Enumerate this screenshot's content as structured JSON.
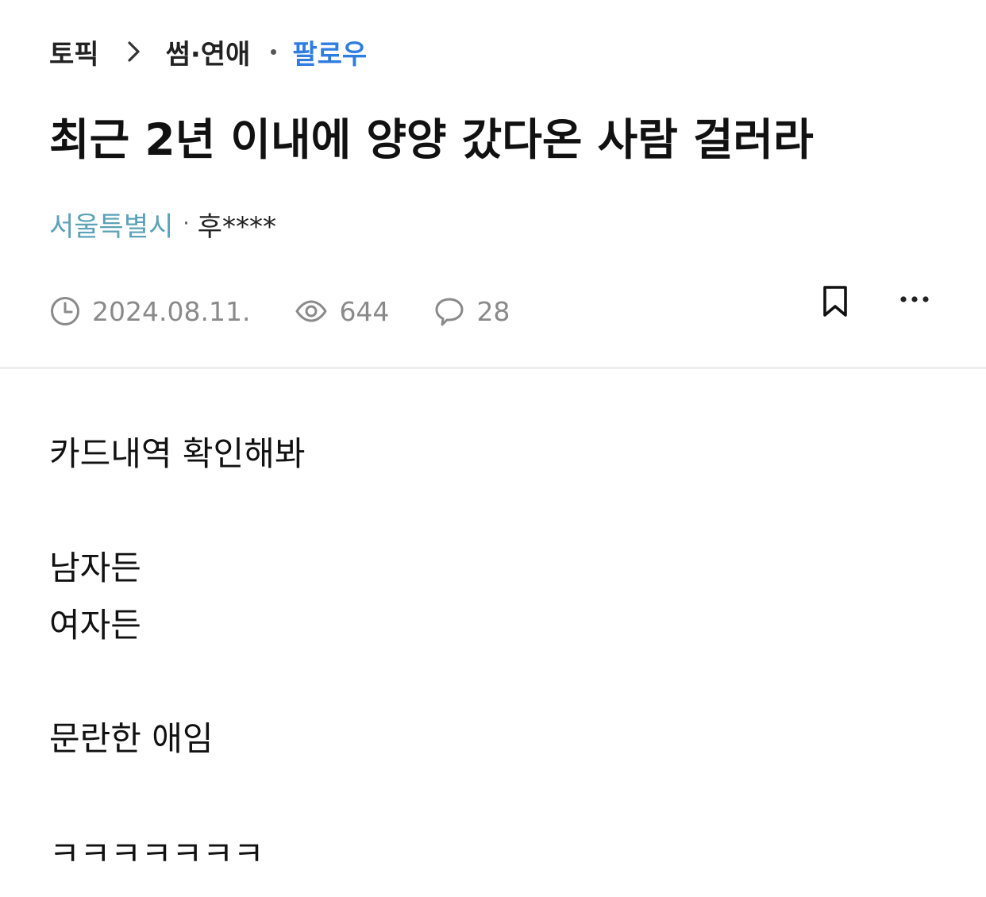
{
  "breadcrumb": {
    "topic": "토픽",
    "category": "썸·연애",
    "follow_label": "팔로우"
  },
  "post": {
    "title": "최근 2년 이내에 양양 갔다온 사람 걸러라",
    "region": "서울특별시",
    "separator": "·",
    "author": "후****",
    "date": "2024.08.11.",
    "views": "644",
    "comments": "28",
    "body_lines": [
      "카드내역 확인해봐",
      "남자든",
      "여자든",
      "문란한 애임",
      "ㅋㅋㅋㅋㅋㅋㅋ"
    ]
  },
  "icons": {
    "chevron": "chevron-right-icon",
    "clock": "clock-icon",
    "eye": "eye-icon",
    "comment": "speech-bubble-icon",
    "bookmark": "bookmark-icon",
    "more": "more-horizontal-icon"
  },
  "colors": {
    "follow": "#2f7de1",
    "region": "#5aa2b8",
    "meta": "#8a8a8a"
  }
}
